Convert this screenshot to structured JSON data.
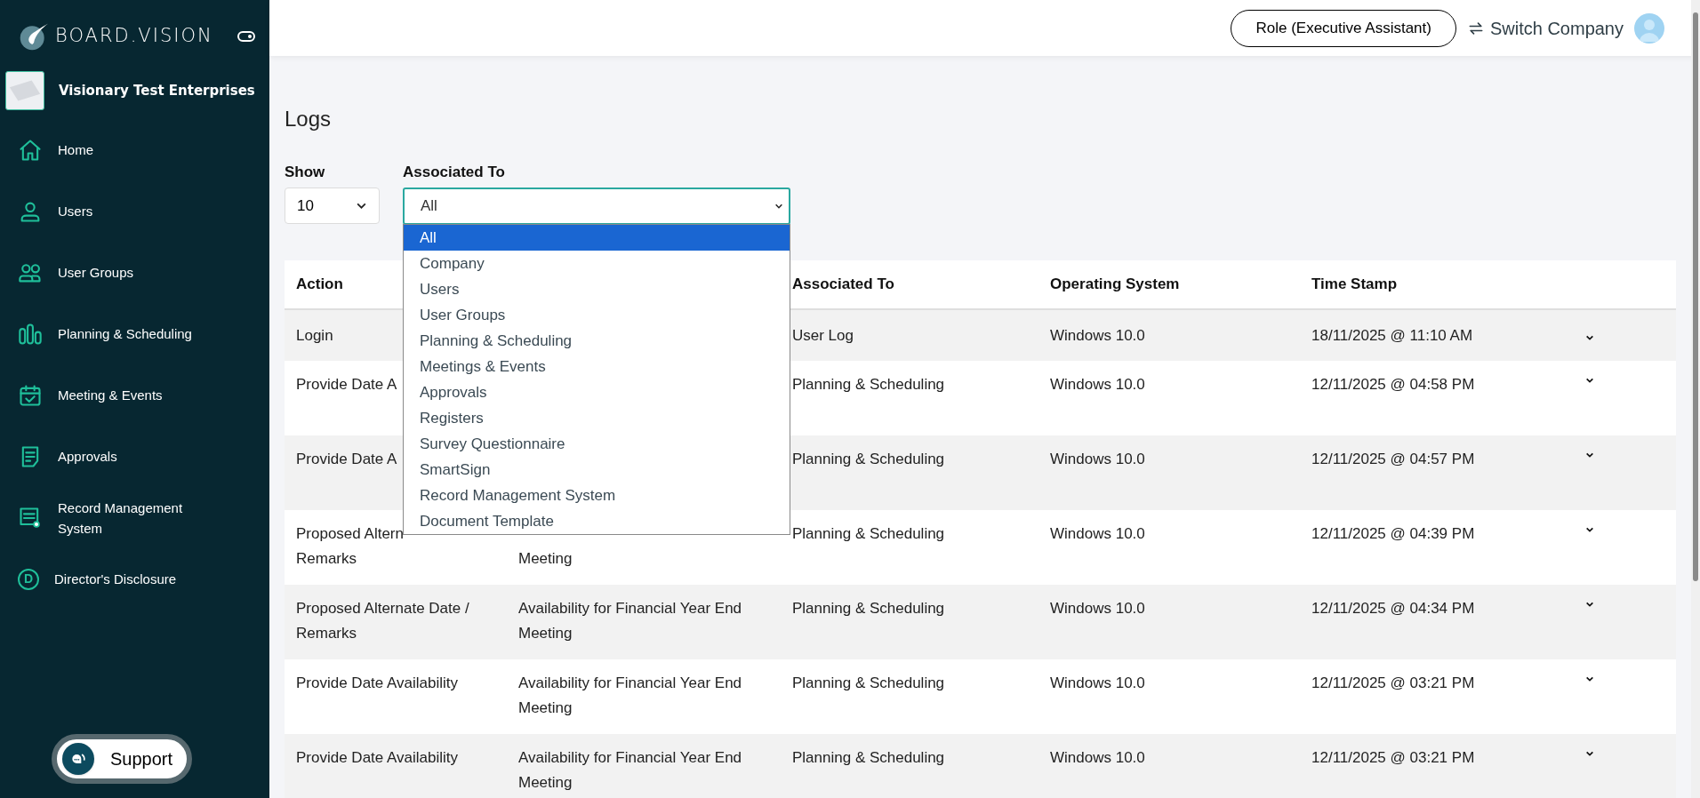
{
  "sidebar": {
    "logo_text": "BOARD.VISION",
    "company": "Visionary Test Enterprises",
    "items": [
      {
        "label": "Home",
        "kind": "home"
      },
      {
        "label": "Users",
        "kind": "user"
      },
      {
        "label": "User Groups",
        "kind": "users"
      },
      {
        "label": "Planning & Scheduling",
        "kind": "bars"
      },
      {
        "label": "Meeting & Events",
        "kind": "calendar"
      },
      {
        "label": "Approvals",
        "kind": "doc"
      },
      {
        "label": "Record Management System",
        "kind": "record"
      },
      {
        "label": "Director's Disclosure",
        "kind": "letter",
        "letter": "D"
      }
    ],
    "support": "Support"
  },
  "topbar": {
    "role": "Role (Executive Assistant)",
    "switch": "Switch Company"
  },
  "page": {
    "title": "Logs",
    "show": {
      "label": "Show",
      "value": "10"
    },
    "associated": {
      "label": "Associated To",
      "value": "All",
      "expanded": true,
      "options": [
        {
          "label": "All",
          "selected": true
        },
        {
          "label": "Company",
          "selected": false
        },
        {
          "label": "Users",
          "selected": false
        },
        {
          "label": "User Groups",
          "selected": false
        },
        {
          "label": "Planning & Scheduling",
          "selected": false
        },
        {
          "label": "Meetings & Events",
          "selected": false
        },
        {
          "label": "Approvals",
          "selected": false
        },
        {
          "label": "Registers",
          "selected": false
        },
        {
          "label": "Survey Questionnaire",
          "selected": false
        },
        {
          "label": "SmartSign",
          "selected": false
        },
        {
          "label": "Record Management System",
          "selected": false
        },
        {
          "label": "Document Template",
          "selected": false
        }
      ]
    }
  },
  "table": {
    "columns": [
      "Action",
      "Associated To",
      "Operating System",
      "Time Stamp"
    ],
    "rows": [
      {
        "action": "Login",
        "associated_to": "User Log",
        "os": "Windows 10.0",
        "time_stamp": "18/11/2025 @ 11:10 AM"
      },
      {
        "action": "Provide Date A",
        "associated_to": "Planning & Scheduling",
        "os": "Windows 10.0",
        "time_stamp": "12/11/2025 @ 04:58 PM"
      },
      {
        "action": "Provide Date A",
        "associated_to": "Planning & Scheduling",
        "os": "Windows 10.0",
        "time_stamp": "12/11/2025 @ 04:57 PM"
      },
      {
        "action": "Proposed Altern\nRemarks",
        "subject": "\nMeeting",
        "associated_to": "Planning & Scheduling",
        "os": "Windows 10.0",
        "time_stamp": "12/11/2025 @ 04:39 PM"
      },
      {
        "action": "Proposed Alternate Date / Remarks",
        "subject": "Availability for Financial Year End Meeting",
        "associated_to": "Planning & Scheduling",
        "os": "Windows 10.0",
        "time_stamp": "12/11/2025 @ 04:34 PM"
      },
      {
        "action": "Provide Date Availability",
        "subject": "Availability for Financial Year End Meeting",
        "associated_to": "Planning & Scheduling",
        "os": "Windows 10.0",
        "time_stamp": "12/11/2025 @ 03:21 PM"
      },
      {
        "action": "Provide Date Availability",
        "subject": "Availability for Financial Year End Meeting",
        "associated_to": "Planning & Scheduling",
        "os": "Windows 10.0",
        "time_stamp": "12/11/2025 @ 03:21 PM"
      }
    ]
  }
}
